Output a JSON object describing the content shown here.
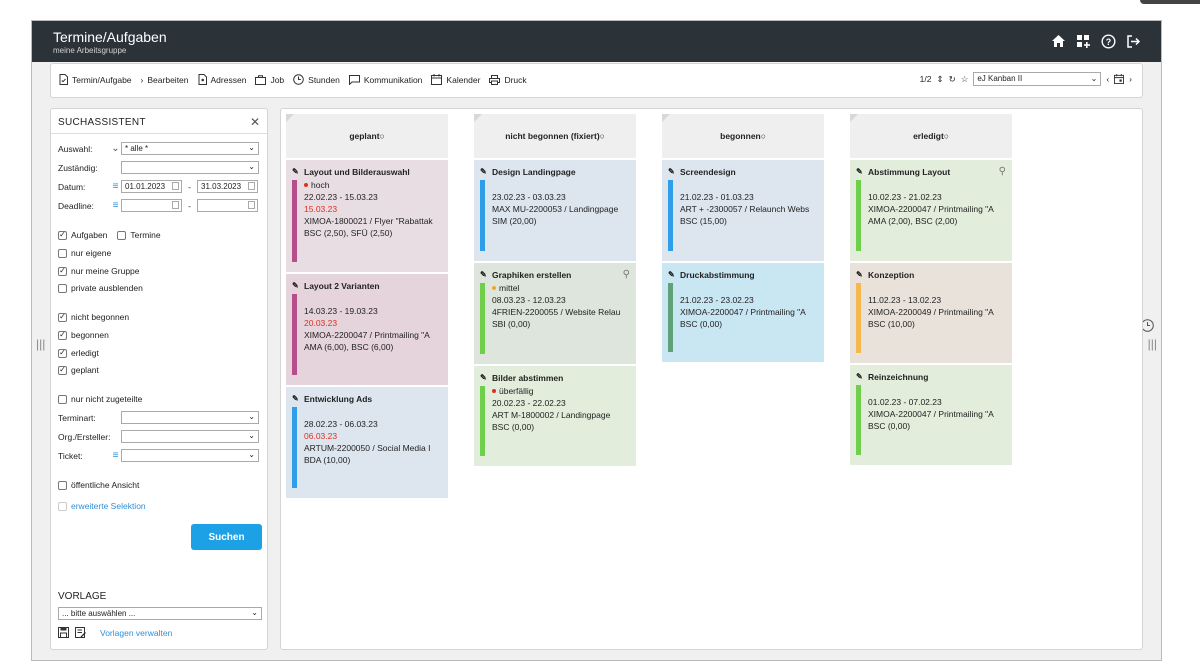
{
  "header": {
    "title": "Termine/Aufgaben",
    "subtitle": "meine Arbeitsgruppe"
  },
  "header_icons": [
    "home-icon",
    "dashboard-add-icon",
    "help-icon",
    "logout-icon"
  ],
  "toolbar": {
    "items": [
      {
        "label": "Termin/Aufgabe",
        "icon": "task-doc-icon"
      },
      {
        "label": "Bearbeiten",
        "icon": "chevron-right-icon"
      },
      {
        "label": "Adressen",
        "icon": "address-doc-icon"
      },
      {
        "label": "Job",
        "icon": "briefcase-icon"
      },
      {
        "label": "Stunden",
        "icon": "clock-icon"
      },
      {
        "label": "Kommunikation",
        "icon": "chat-icon"
      },
      {
        "label": "Kalender",
        "icon": "calendar-icon"
      },
      {
        "label": "Druck",
        "icon": "printer-icon"
      }
    ],
    "pager": "1/2",
    "view_select": "eJ Kanban II"
  },
  "sidebar": {
    "title": "SUCHASSISTENT",
    "auswahl_label": "Auswahl:",
    "auswahl_value": "* alle *",
    "zustaendig_label": "Zuständig:",
    "datum_label": "Datum:",
    "datum_from": "01.01.2023",
    "datum_to": "31.03.2023",
    "deadline_label": "Deadline:",
    "dash": "-",
    "checks": {
      "aufgaben": "Aufgaben",
      "termine": "Termine",
      "nur_eigene": "nur eigene",
      "nur_meine_gruppe": "nur meine Gruppe",
      "private": "private ausblenden",
      "nicht_begonnen": "nicht begonnen",
      "begonnen": "begonnen",
      "erledigt": "erledigt",
      "geplant": "geplant",
      "nur_nicht_zugeteilte": "nur nicht zugeteilte",
      "oeffentliche": "öffentliche Ansicht"
    },
    "terminart_label": "Terminart:",
    "org_label": "Org./Ersteller:",
    "ticket_label": "Ticket:",
    "erweiterte": "erweiterte Selektion",
    "search_button": "Suchen",
    "vorlage_title": "VORLAGE",
    "vorlage_select": "... bitte auswählen ...",
    "vorlagen_verwalten": "Vorlagen verwalten"
  },
  "columns": [
    {
      "title": "geplant",
      "cards": [
        {
          "title": "Layout und Bilderauswahl",
          "prio": "hoch",
          "dates": "22.02.23 - 15.03.23",
          "deadline": "15.03.23",
          "ref": "XIMOA-1800021 / Flyer \"Rabattak",
          "people": "BSC (2,50), SFÜ (2,50)"
        },
        {
          "title": "Layout 2 Varianten",
          "dates": "14.03.23 - 19.03.23",
          "deadline": "20.03.23",
          "ref": "XIMOA-2200047 / Printmailing \"A",
          "people": "AMA (6,00), BSC (6,00)"
        },
        {
          "title": "Entwicklung Ads",
          "dates": "28.02.23 - 06.03.23",
          "deadline": "06.03.23",
          "ref": "ARTUM-2200050 / Social Media I",
          "people": "BDA (10,00)"
        }
      ]
    },
    {
      "title": "nicht begonnen (fixiert)",
      "cards": [
        {
          "title": "Design Landingpage",
          "dates": "23.02.23 - 03.03.23",
          "ref": "MAX MU-2200053 / Landingpage",
          "people": "SIM (20,00)"
        },
        {
          "title": "Graphiken erstellen",
          "prio": "mittel",
          "dates": "08.03.23 - 12.03.23",
          "ref": "4FRIEN-2200055 / Website Relau",
          "people": "SBI (0,00)"
        },
        {
          "title": "Bilder abstimmen",
          "prio": "überfällig",
          "dates": "20.02.23 - 22.02.23",
          "ref": "ART M-1800002 / Landingpage",
          "people": "BSC (0,00)"
        }
      ]
    },
    {
      "title": "begonnen",
      "cards": [
        {
          "title": "Screendesign",
          "dates": "21.02.23 - 01.03.23",
          "ref": "ART + -2300057 / Relaunch Webs",
          "people": "BSC (15,00)"
        },
        {
          "title": "Druckabstimmung",
          "dates": "21.02.23 - 23.02.23",
          "ref": "XIMOA-2200047 / Printmailing \"A",
          "people": "BSC (0,00)"
        }
      ]
    },
    {
      "title": "erledigt",
      "cards": [
        {
          "title": "Abstimmung Layout",
          "dates": "10.02.23 - 21.02.23",
          "ref": "XIMOA-2200047 / Printmailing \"A",
          "people": "AMA (2,00), BSC (2,00)"
        },
        {
          "title": "Konzeption",
          "dates": "11.02.23 - 13.02.23",
          "ref": "XIMOA-2200049 / Printmailing \"A",
          "people": "BSC (10,00)"
        },
        {
          "title": "Reinzeichnung",
          "dates": "01.02.23 - 07.02.23",
          "ref": "XIMOA-2200047 / Printmailing \"A",
          "people": "BSC (0,00)"
        }
      ]
    }
  ],
  "colors": {
    "header_bg": "#2c3338",
    "accent": "#1da1e6",
    "overdue": "#e0301e",
    "medium": "#f0a830"
  }
}
